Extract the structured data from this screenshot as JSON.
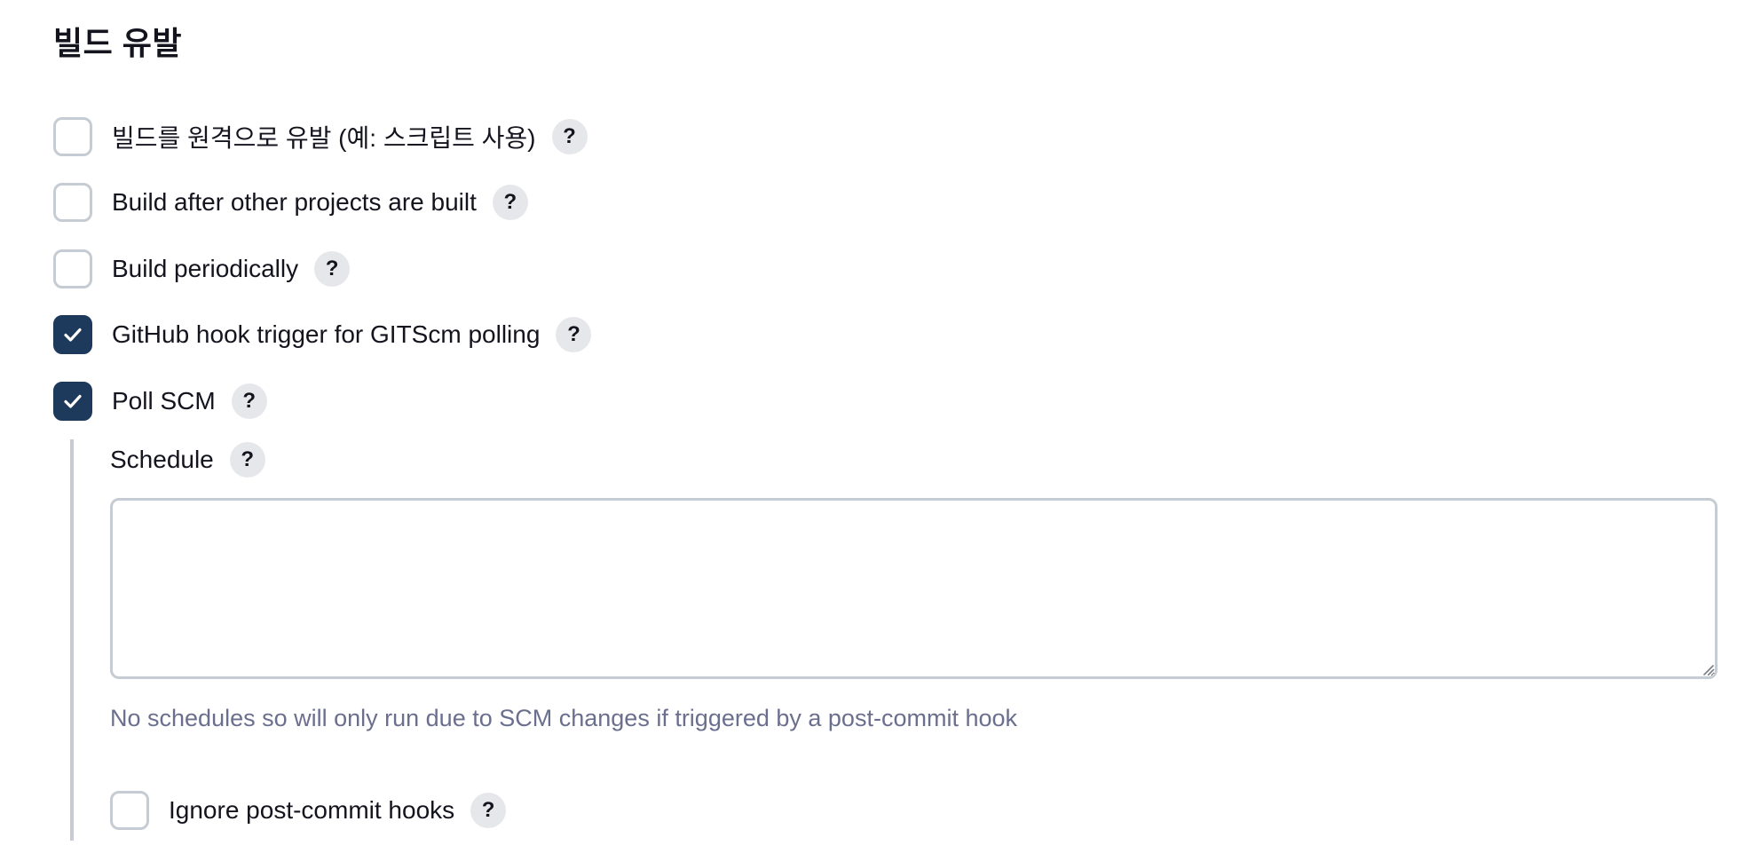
{
  "section": {
    "title": "빌드 유발"
  },
  "triggers": [
    {
      "label": "빌드를 원격으로 유발 (예: 스크립트 사용)",
      "checked": false
    },
    {
      "label": "Build after other projects are built",
      "checked": false
    },
    {
      "label": "Build periodically",
      "checked": false
    },
    {
      "label": "GitHub hook trigger for GITScm polling",
      "checked": true
    },
    {
      "label": "Poll SCM",
      "checked": true
    }
  ],
  "poll_scm": {
    "schedule_label": "Schedule",
    "schedule_value": "",
    "hint": "No schedules so will only run due to SCM changes if triggered by a post-commit hook",
    "ignore_hooks": {
      "label": "Ignore post-commit hooks",
      "checked": false
    }
  },
  "help_symbol": "?",
  "colors": {
    "checked_fill": "#1d3a5c",
    "checkbox_border": "#c6ccd3",
    "help_bg": "#e6e7ea",
    "hint_text": "#6b6f8e"
  },
  "icons": {
    "checkmark": "check-icon",
    "help": "help-icon",
    "resize": "resize-grip-icon"
  }
}
